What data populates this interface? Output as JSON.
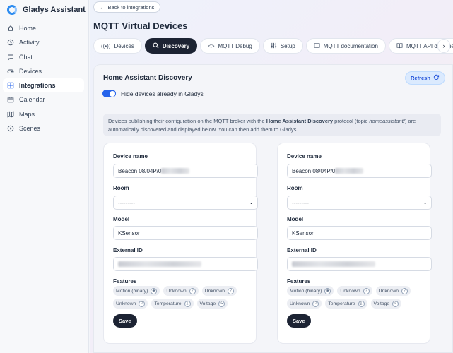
{
  "app": {
    "name": "Gladys Assistant"
  },
  "sidebar": {
    "items": [
      {
        "label": "Home",
        "icon": "home-icon"
      },
      {
        "label": "Activity",
        "icon": "activity-icon"
      },
      {
        "label": "Chat",
        "icon": "chat-icon"
      },
      {
        "label": "Devices",
        "icon": "devices-icon"
      },
      {
        "label": "Integrations",
        "icon": "integrations-icon",
        "active": true
      },
      {
        "label": "Calendar",
        "icon": "calendar-icon"
      },
      {
        "label": "Maps",
        "icon": "map-icon"
      },
      {
        "label": "Scenes",
        "icon": "play-icon"
      }
    ]
  },
  "header": {
    "back_label": "Back to integrations",
    "title": "MQTT Virtual Devices"
  },
  "tabs": [
    {
      "label": "Devices",
      "icon": "radio-icon"
    },
    {
      "label": "Discovery",
      "icon": "search-icon",
      "active": true
    },
    {
      "label": "MQTT Debug",
      "icon": "code-icon"
    },
    {
      "label": "Setup",
      "icon": "sliders-icon"
    },
    {
      "label": "MQTT documentation",
      "icon": "book-icon"
    },
    {
      "label": "MQTT API document",
      "icon": "book-icon"
    }
  ],
  "discovery": {
    "title": "Home Assistant Discovery",
    "refresh_label": "Refresh",
    "toggle_label": "Hide devices already in Gladys",
    "toggle_on": true,
    "info_prefix": "Devices publishing their configuration on the MQTT broker with the ",
    "info_bold": "Home Assistant Discovery",
    "info_mid": " protocol (topic ",
    "info_italic": "homeassistant/",
    "info_suffix": ") are automatically discovered and displayed below. You can then add them to Gladys."
  },
  "labels": {
    "device_name": "Device name",
    "room": "Room",
    "model": "Model",
    "external_id": "External ID",
    "features": "Features",
    "save": "Save"
  },
  "cards": [
    {
      "device_name": "Beacon 08/04P/0",
      "room": "---------",
      "model": "KSensor",
      "features": [
        "Motion (binary)",
        "Unknown",
        "Unknown",
        "Unknown",
        "Temperature",
        "Voltage"
      ]
    },
    {
      "device_name": "Beacon 08/04P/0",
      "room": "---------",
      "model": "KSensor",
      "features": [
        "Motion (binary)",
        "Unknown",
        "Unknown",
        "Unknown",
        "Temperature",
        "Voltage"
      ]
    }
  ],
  "colors": {
    "accent": "#2563eb",
    "dark_button": "#1c2333",
    "refresh_bg": "#dbeafe"
  }
}
